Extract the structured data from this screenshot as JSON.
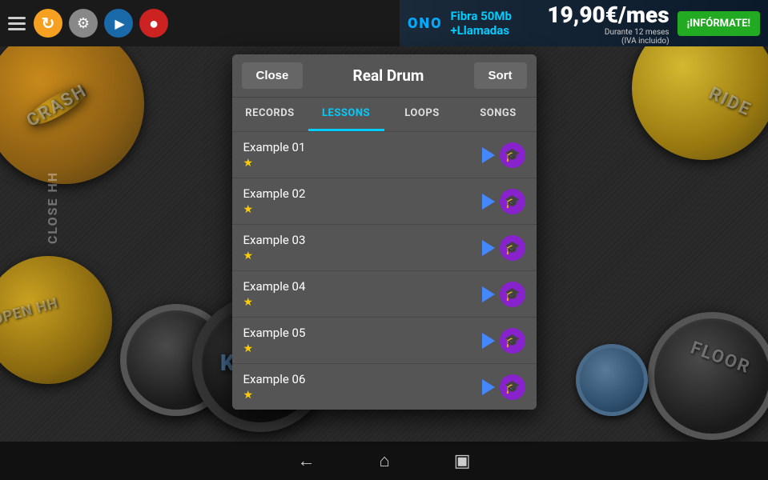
{
  "toolbar": {
    "menu_label": "☰",
    "refresh_label": "↻",
    "settings_label": "⚙",
    "play_label": "▶",
    "record_label": "●"
  },
  "ad": {
    "logo": "ONO",
    "line1": "Fibra 50Mb",
    "line2": "+Llamadas",
    "price": "19,90€/mes",
    "subtitle": "Durante 12 meses",
    "note": "(IVA incluido)",
    "cta": "¡INFÓRMATE!"
  },
  "modal": {
    "close_label": "Close",
    "title": "Real Drum",
    "sort_label": "Sort",
    "tabs": [
      {
        "id": "records",
        "label": "RECORDS",
        "active": false
      },
      {
        "id": "lessons",
        "label": "LESSONS",
        "active": true
      },
      {
        "id": "loops",
        "label": "LOOPS",
        "active": false
      },
      {
        "id": "songs",
        "label": "SONGS",
        "active": false
      }
    ],
    "songs": [
      {
        "name": "Example 01",
        "star": "★"
      },
      {
        "name": "Example 02",
        "star": "★"
      },
      {
        "name": "Example 03",
        "star": "★"
      },
      {
        "name": "Example 04",
        "star": "★"
      },
      {
        "name": "Example 05",
        "star": "★"
      },
      {
        "name": "Example 06",
        "star": "★"
      }
    ]
  },
  "drum": {
    "crash_label": "CRASH",
    "ride_label": "RIDE",
    "close_hh_label": "CLOSE HH",
    "open_hh_label": "OPEN HH",
    "kick_label": "KICK",
    "floor_label": "FLOOR"
  },
  "bottom_nav": {
    "back": "←",
    "home": "⌂",
    "recents": "▣"
  }
}
